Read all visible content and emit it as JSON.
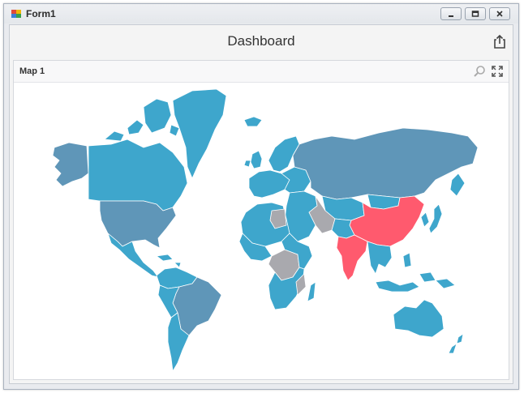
{
  "window": {
    "title": "Form1",
    "buttons": [
      "minimize",
      "maximize",
      "close"
    ]
  },
  "dashboard": {
    "title": "Dashboard",
    "export_icon": "export-icon"
  },
  "map_panel": {
    "title": "Map 1",
    "tools": [
      "zoom-icon",
      "fullscreen-icon"
    ],
    "colors": {
      "default": "#3ea6cc",
      "dark": "#5f96b8",
      "highlight": "#ff5a6e",
      "no_data": "#a9a9ae",
      "border": "#ffffff"
    },
    "highlighted_regions": [
      "china",
      "india"
    ],
    "dark_regions": [
      "usa",
      "alaska",
      "brazil",
      "russia"
    ],
    "no_data_regions": [
      "iran",
      "libya",
      "central-africa",
      "mozambique"
    ]
  }
}
